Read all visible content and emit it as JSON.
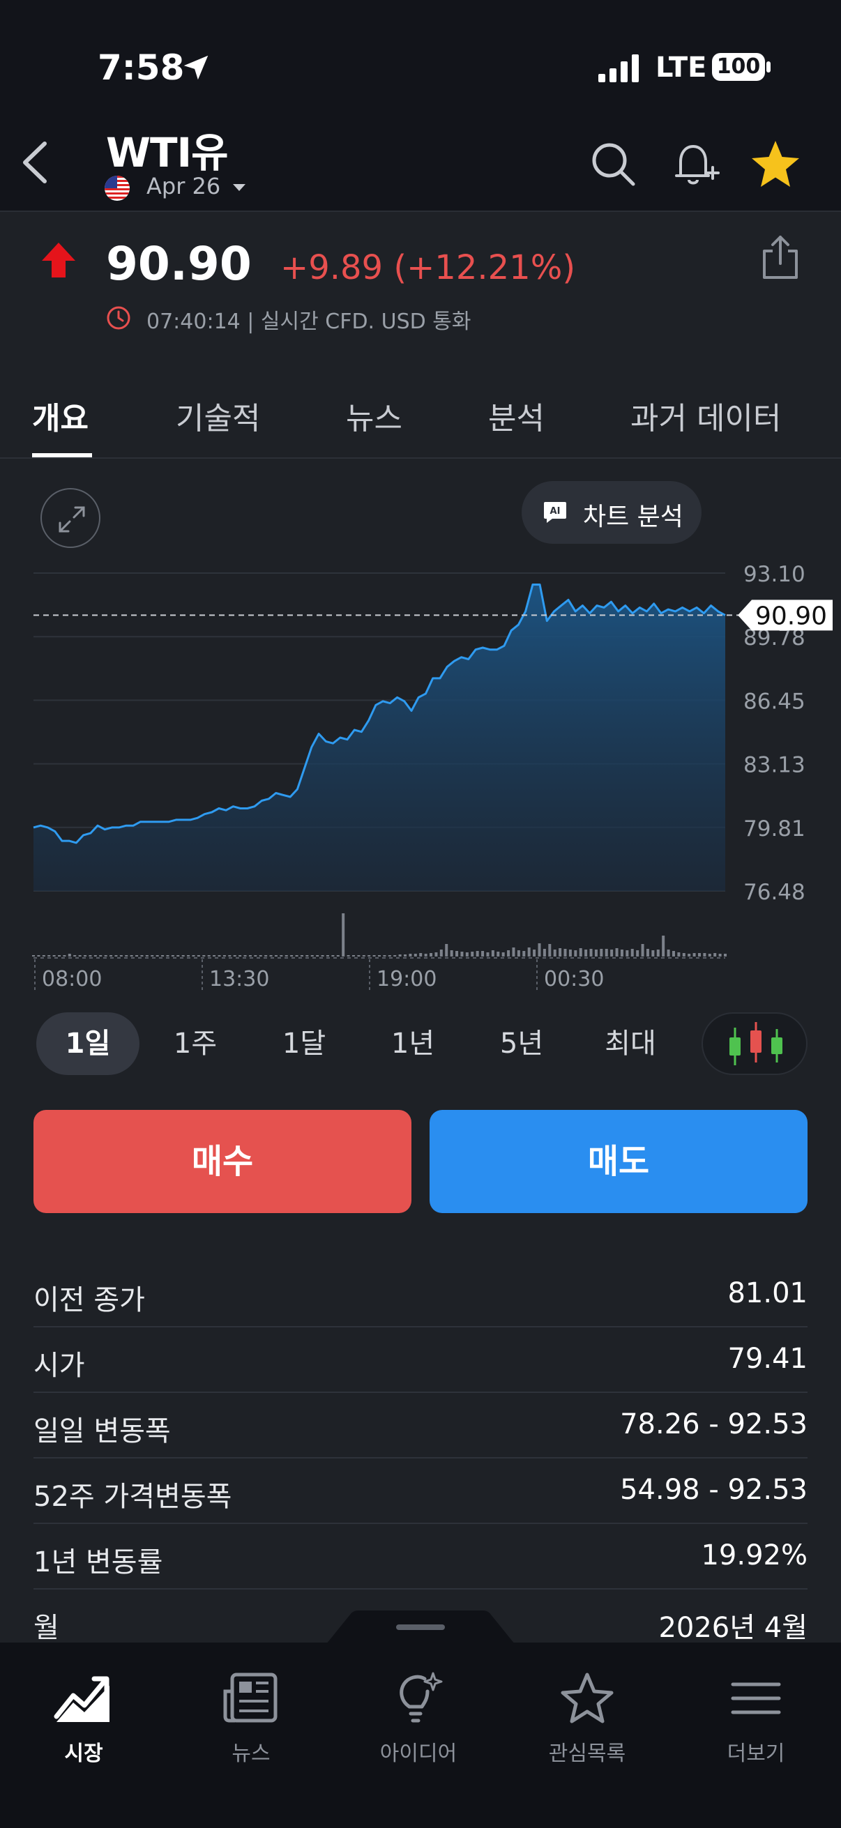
{
  "status_bar": {
    "time": "7:58",
    "network": "LTE",
    "battery": "100"
  },
  "header": {
    "ticker": "WTI유",
    "contract": "Apr 26"
  },
  "quote": {
    "price": "90.90",
    "change": "+9.89 (+12.21%)",
    "meta": "07:40:14 | 실시간 CFD. USD 통화",
    "up_color": "#e5141b",
    "change_color": "#e8504f"
  },
  "tabs": [
    "개요",
    "기술적",
    "뉴스",
    "분석",
    "과거 데이터"
  ],
  "ai_button": {
    "label": "차트 분석",
    "badge": "AI"
  },
  "chart_data": {
    "type": "area",
    "y_ticks": [
      "93.10",
      "89.78",
      "86.45",
      "83.13",
      "79.81",
      "76.48"
    ],
    "ylim": [
      76.48,
      93.1
    ],
    "x_ticks": [
      "08:00",
      "13:30",
      "19:00",
      "00:30"
    ],
    "current_value": 90.9,
    "current_label": "90.90",
    "line_color": "#2f9bf0",
    "series": [
      {
        "values": [
          79.8,
          79.9,
          79.8,
          79.6,
          79.1,
          79.1,
          79.0,
          79.4,
          79.5,
          79.9,
          79.7,
          79.8,
          79.8,
          79.9,
          79.9,
          80.1,
          80.1,
          80.1,
          80.1,
          80.1,
          80.2,
          80.2,
          80.2,
          80.3,
          80.5,
          80.6,
          80.8,
          80.7,
          80.9,
          80.8,
          80.8,
          80.9,
          81.2,
          81.3,
          81.6,
          81.5,
          81.4,
          81.8,
          82.9,
          84.0,
          84.7,
          84.3,
          84.2,
          84.5,
          84.4,
          84.9,
          84.8,
          85.4,
          86.2,
          86.4,
          86.3,
          86.6,
          86.4,
          85.9,
          86.6,
          86.8,
          87.6,
          87.6,
          88.2,
          88.5,
          88.7,
          88.6,
          89.1,
          89.2,
          89.1,
          89.1,
          89.3,
          90.1,
          90.4,
          91.1,
          92.5,
          92.5,
          90.6,
          91.1,
          91.4,
          91.7,
          91.1,
          91.4,
          91.0,
          91.4,
          91.3,
          91.6,
          91.1,
          91.4,
          91.0,
          91.3,
          91.1,
          91.5,
          91.0,
          91.2,
          91.1,
          91.3,
          91.1,
          91.3,
          91.0,
          91.4,
          91.1,
          90.9
        ]
      }
    ],
    "volume": [
      0,
      0,
      2,
      0,
      0,
      1,
      0,
      4,
      2,
      0,
      0,
      0,
      0,
      0,
      0,
      1,
      0,
      1,
      0,
      0,
      0,
      0,
      0,
      0,
      0,
      0,
      0,
      0,
      0,
      0,
      0,
      0,
      0,
      0,
      0,
      0,
      0,
      0,
      0,
      0,
      0,
      0,
      0,
      0,
      0,
      0,
      0,
      0,
      0,
      0,
      0,
      0,
      0,
      0,
      0,
      0,
      0,
      0,
      0,
      0,
      62,
      0,
      0,
      0,
      0,
      0,
      0,
      0,
      0,
      0,
      2,
      3,
      3,
      4,
      4,
      5,
      4,
      5,
      6,
      10,
      18,
      9,
      8,
      7,
      6,
      7,
      8,
      8,
      6,
      9,
      7,
      6,
      9,
      13,
      9,
      8,
      13,
      10,
      19,
      11,
      18,
      10,
      12,
      11,
      10,
      9,
      12,
      10,
      11,
      10,
      11,
      11,
      10,
      12,
      10,
      9,
      11,
      9,
      18,
      11,
      9,
      10,
      30,
      10,
      8,
      6,
      5,
      4,
      5,
      5,
      5,
      4,
      5,
      4,
      4
    ]
  },
  "range_options": [
    "1일",
    "1주",
    "1달",
    "1년",
    "5년",
    "최대"
  ],
  "active_range": "1일",
  "actions": {
    "buy": "매수",
    "sell": "매도",
    "buy_color": "#e5524f",
    "sell_color": "#2a8ef0"
  },
  "stats": [
    {
      "label": "이전 종가",
      "value": "81.01"
    },
    {
      "label": "시가",
      "value": "79.41"
    },
    {
      "label": "일일 변동폭",
      "value": "78.26 - 92.53"
    },
    {
      "label": "52주 가격변동폭",
      "value": "54.98 - 92.53"
    },
    {
      "label": "1년 변동률",
      "value": "19.92%"
    },
    {
      "label": "월",
      "value": "2026년 4월"
    }
  ],
  "bottom_nav": [
    {
      "label": "시장",
      "icon": "chart-trend-icon",
      "active": true
    },
    {
      "label": "뉴스",
      "icon": "newspaper-icon",
      "active": false
    },
    {
      "label": "아이디어",
      "icon": "lightbulb-icon",
      "active": false
    },
    {
      "label": "관심목록",
      "icon": "star-outline-icon",
      "active": false
    },
    {
      "label": "더보기",
      "icon": "hamburger-icon",
      "active": false
    }
  ]
}
